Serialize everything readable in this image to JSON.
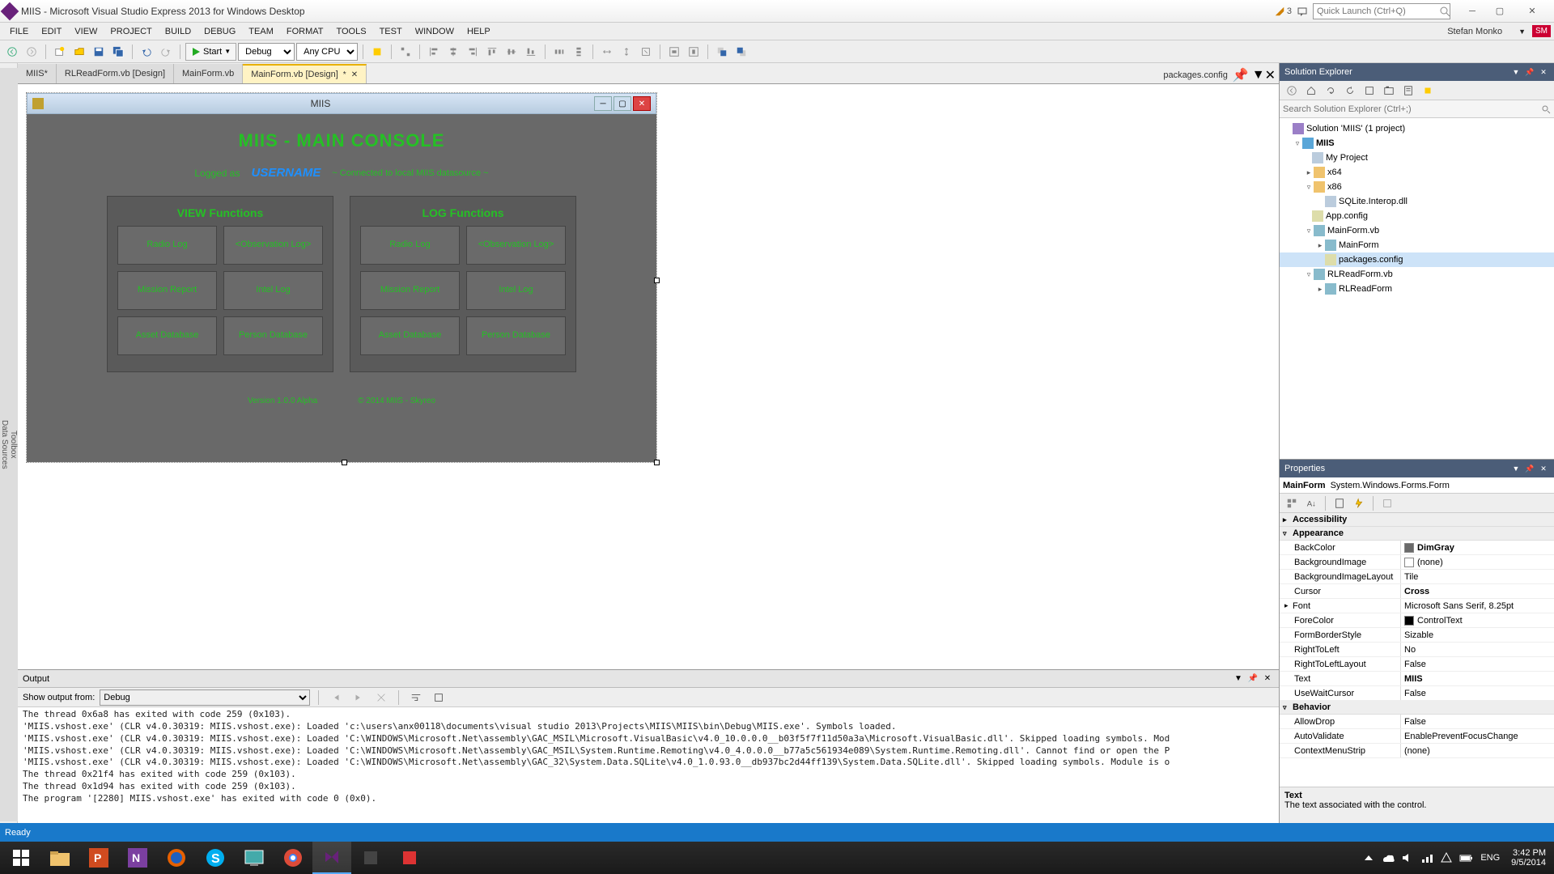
{
  "titlebar": {
    "title": "MIIS - Microsoft Visual Studio Express 2013 for Windows Desktop",
    "notifications": "3",
    "quicklaunch_placeholder": "Quick Launch (Ctrl+Q)"
  },
  "menu": {
    "items": [
      "FILE",
      "EDIT",
      "VIEW",
      "PROJECT",
      "BUILD",
      "DEBUG",
      "TEAM",
      "FORMAT",
      "TOOLS",
      "TEST",
      "WINDOW",
      "HELP"
    ],
    "username": "Stefan Monko",
    "userbadge": "SM"
  },
  "toolbar": {
    "start": "Start",
    "config": "Debug",
    "platform": "Any CPU"
  },
  "tabs": {
    "items": [
      {
        "label": "MIIS*"
      },
      {
        "label": "RLReadForm.vb [Design]"
      },
      {
        "label": "MainForm.vb"
      },
      {
        "label": "MainForm.vb [Design]"
      }
    ],
    "active": 3,
    "pinned": "packages.config"
  },
  "form": {
    "window_title": "MIIS",
    "heading": "MIIS - MAIN CONSOLE",
    "logged_as_label": "Logged as",
    "username": "USERNAME",
    "connection": "~ Connected to local MIIS datasource ~",
    "view_title": "VIEW Functions",
    "log_title": "LOG Functions",
    "buttons": {
      "radio": "Radio Log",
      "obs": "<Observation Log>",
      "mission": "Mission Report",
      "intel": "Intel Log",
      "asset": "Asset Database",
      "person": "Person Database"
    },
    "version": "Version 1.0.0 Alpha",
    "copyright": "© 2014 MIIS - Skyreo"
  },
  "output": {
    "title": "Output",
    "show_from_label": "Show output from:",
    "show_from_value": "Debug",
    "lines": [
      "The thread 0x6a8 has exited with code 259 (0x103).",
      "'MIIS.vshost.exe' (CLR v4.0.30319: MIIS.vshost.exe): Loaded 'c:\\users\\anx00118\\documents\\visual studio 2013\\Projects\\MIIS\\MIIS\\bin\\Debug\\MIIS.exe'. Symbols loaded.",
      "'MIIS.vshost.exe' (CLR v4.0.30319: MIIS.vshost.exe): Loaded 'C:\\WINDOWS\\Microsoft.Net\\assembly\\GAC_MSIL\\Microsoft.VisualBasic\\v4.0_10.0.0.0__b03f5f7f11d50a3a\\Microsoft.VisualBasic.dll'. Skipped loading symbols. Mod",
      "'MIIS.vshost.exe' (CLR v4.0.30319: MIIS.vshost.exe): Loaded 'C:\\WINDOWS\\Microsoft.Net\\assembly\\GAC_MSIL\\System.Runtime.Remoting\\v4.0_4.0.0.0__b77a5c561934e089\\System.Runtime.Remoting.dll'. Cannot find or open the P",
      "'MIIS.vshost.exe' (CLR v4.0.30319: MIIS.vshost.exe): Loaded 'C:\\WINDOWS\\Microsoft.Net\\assembly\\GAC_32\\System.Data.SQLite\\v4.0_1.0.93.0__db937bc2d44ff139\\System.Data.SQLite.dll'. Skipped loading symbols. Module is o",
      "The thread 0x21f4 has exited with code 259 (0x103).",
      "The thread 0x1d94 has exited with code 259 (0x103).",
      "The program '[2280] MIIS.vshost.exe' has exited with code 0 (0x0)."
    ]
  },
  "solution": {
    "title": "Solution Explorer",
    "search_placeholder": "Search Solution Explorer (Ctrl+;)",
    "root": "Solution 'MIIS' (1 project)",
    "proj": "MIIS",
    "items": {
      "myproject": "My Project",
      "x64": "x64",
      "x86": "x86",
      "sqlite": "SQLite.Interop.dll",
      "appconfig": "App.config",
      "mainformvb": "MainForm.vb",
      "mainform": "MainForm",
      "packagesconfig": "packages.config",
      "rlreadformvb": "RLReadForm.vb",
      "rlreadform": "RLReadForm"
    }
  },
  "properties": {
    "title": "Properties",
    "object_name": "MainForm",
    "object_type": "System.Windows.Forms.Form",
    "categories": {
      "accessibility": "Accessibility",
      "appearance": "Appearance",
      "behavior": "Behavior"
    },
    "rows": [
      {
        "name": "BackColor",
        "value": "DimGray",
        "swatch": "#696969",
        "bold": true
      },
      {
        "name": "BackgroundImage",
        "value": "(none)",
        "swatch": "#fff"
      },
      {
        "name": "BackgroundImageLayout",
        "value": "Tile"
      },
      {
        "name": "Cursor",
        "value": "Cross",
        "bold": true
      },
      {
        "name": "Font",
        "value": "Microsoft Sans Serif, 8.25pt",
        "expand": true
      },
      {
        "name": "ForeColor",
        "value": "ControlText",
        "swatch": "#000"
      },
      {
        "name": "FormBorderStyle",
        "value": "Sizable"
      },
      {
        "name": "RightToLeft",
        "value": "No"
      },
      {
        "name": "RightToLeftLayout",
        "value": "False"
      },
      {
        "name": "Text",
        "value": "MIIS",
        "bold": true
      },
      {
        "name": "UseWaitCursor",
        "value": "False"
      }
    ],
    "behavior_rows": [
      {
        "name": "AllowDrop",
        "value": "False"
      },
      {
        "name": "AutoValidate",
        "value": "EnablePreventFocusChange"
      },
      {
        "name": "ContextMenuStrip",
        "value": "(none)"
      }
    ],
    "desc_title": "Text",
    "desc_text": "The text associated with the control."
  },
  "statusbar": {
    "text": "Ready"
  },
  "sidepanels": {
    "datasources": "Data Sources",
    "toolbox": "Toolbox"
  },
  "taskbar": {
    "time": "3:42 PM",
    "date": "9/5/2014",
    "lang": "ENG"
  }
}
